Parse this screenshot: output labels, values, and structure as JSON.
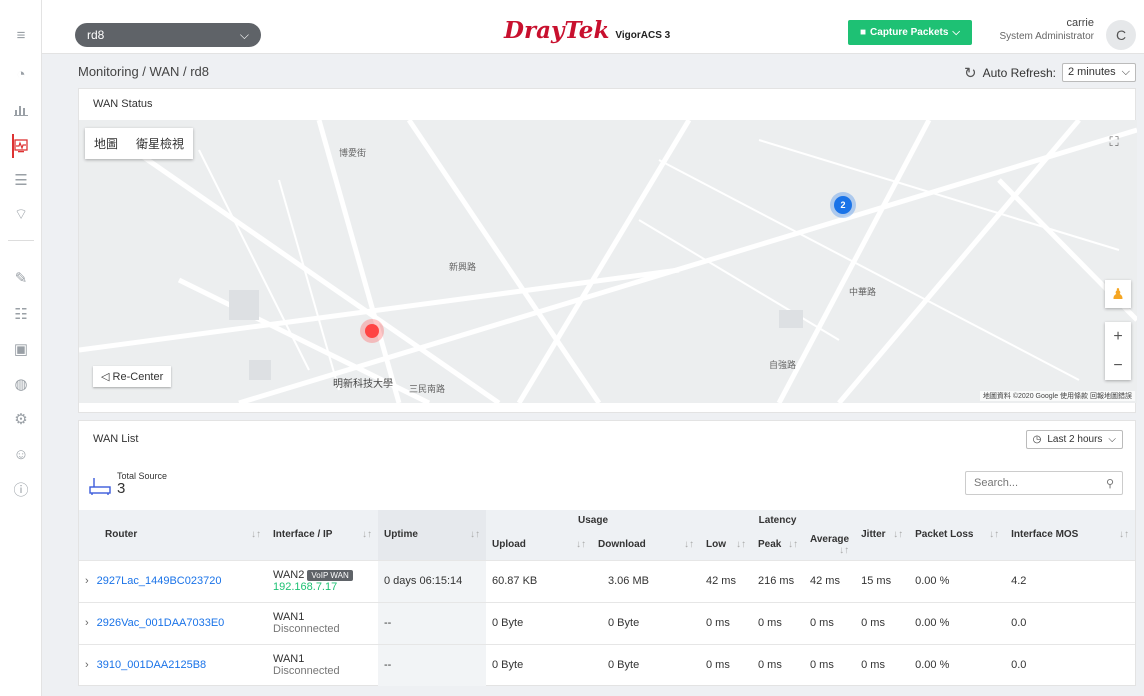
{
  "header": {
    "router_selected": "rd8",
    "brand": "DrayTek",
    "product": "VigorACS 3",
    "capture_button": "Capture Packets",
    "user_name": "carrie",
    "user_role": "System Administrator",
    "avatar_initial": "C"
  },
  "breadcrumb": "Monitoring / WAN / rd8",
  "auto_refresh": {
    "label": "Auto Refresh:",
    "value": "2 minutes"
  },
  "wan_status": {
    "title": "WAN Status",
    "map_tabs": [
      "地圖",
      "衛星檢視"
    ],
    "recenter": "Re-Center",
    "cluster_count": "2",
    "attribution": "地圖資料 ©2020 Google  使用條款  回報地圖錯誤",
    "place_labels": [
      "明新科技大學",
      "三民南路",
      "自強路",
      "中華路",
      "博愛街",
      "新興路"
    ]
  },
  "wan_list": {
    "title": "WAN List",
    "time_range": "Last 2 hours",
    "total_label": "Total Source",
    "total_count": "3",
    "search_placeholder": "Search...",
    "columns": {
      "router": "Router",
      "interface": "Interface / IP",
      "uptime": "Uptime",
      "usage": "Usage",
      "upload": "Upload",
      "download": "Download",
      "latency": "Latency",
      "low": "Low",
      "peak": "Peak",
      "average": "Average",
      "jitter": "Jitter",
      "packet_loss": "Packet Loss",
      "mos": "Interface MOS"
    },
    "rows": [
      {
        "router": "2927Lac_1449BC023720",
        "iface": "WAN2",
        "badge": "VoIP WAN",
        "ip": "192.168.7.17",
        "uptime": "0 days 06:15:14",
        "upload": "60.87 KB",
        "download": "3.06 MB",
        "low": "42 ms",
        "peak": "216 ms",
        "avg": "42 ms",
        "jitter": "15 ms",
        "loss": "0.00 %",
        "mos": "4.2"
      },
      {
        "router": "2926Vac_001DAA7033E0",
        "iface": "WAN1",
        "badge": "",
        "ip": "Disconnected",
        "uptime": "--",
        "upload": "0 Byte",
        "download": "0 Byte",
        "low": "0 ms",
        "peak": "0 ms",
        "avg": "0 ms",
        "jitter": "0 ms",
        "loss": "0.00 %",
        "mos": "0.0"
      },
      {
        "router": "3910_001DAA2125B8",
        "iface": "WAN1",
        "badge": "",
        "ip": "Disconnected",
        "uptime": "--",
        "upload": "0 Byte",
        "download": "0 Byte",
        "low": "0 ms",
        "peak": "0 ms",
        "avg": "0 ms",
        "jitter": "0 ms",
        "loss": "0.00 %",
        "mos": "0.0"
      }
    ]
  }
}
